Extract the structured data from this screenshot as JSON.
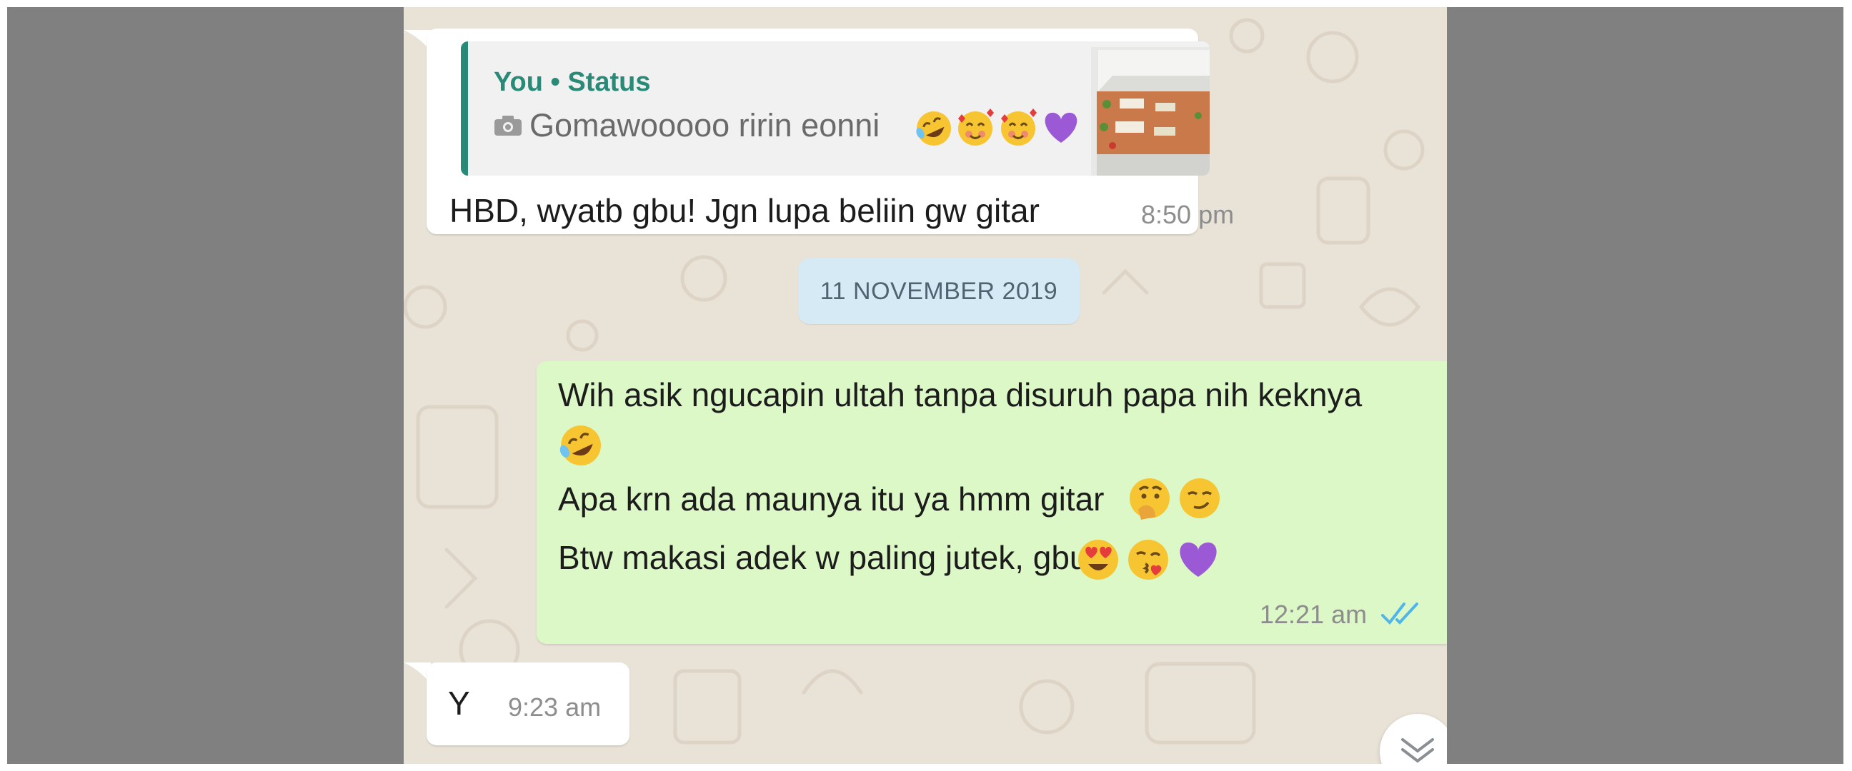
{
  "chat": {
    "reply_message": {
      "quoted_sender": "You • Status",
      "quoted_icon": "camera-icon",
      "quoted_text": "Gomawooooo ririn eonni",
      "quoted_emojis": [
        "rolling-laughing-emoji",
        "smiling-hearts-emoji",
        "smiling-hearts-emoji",
        "purple-heart-emoji"
      ],
      "text": "HBD, wyatb gbu! Jgn lupa beliin gw gitar",
      "time": "8:50 pm"
    },
    "date_separator": "11 NOVEMBER 2019",
    "sent_message": {
      "lines": [
        "Wih asik ngucapin ultah tanpa disuruh papa nih keknya",
        "Apa krn ada maunya itu ya hmm gitar",
        "Btw makasi adek w paling jutek, gbu"
      ],
      "emojis": [
        "rolling-laughing-emoji",
        "thinking-hand-emoji",
        "smirk-emoji",
        "heart-eyes-emoji",
        "kiss-emoji",
        "purple-heart-emoji"
      ],
      "time": "12:21 am",
      "status_icon": "double-check-read-icon"
    },
    "received_message": {
      "text": "Y",
      "time": "9:23 am"
    },
    "scroll_button_icon": "chevron-double-down-icon"
  },
  "colors": {
    "chat_background": "#e9e2d7",
    "frame_background": "#808080",
    "incoming_bubble": "#ffffff",
    "outgoing_bubble": "#dcf8c6",
    "quote_accent": "#2a8a78",
    "date_pill": "#d5eaf4",
    "read_ticks": "#4fb6ec",
    "purple_heart": "#9b59d6"
  }
}
